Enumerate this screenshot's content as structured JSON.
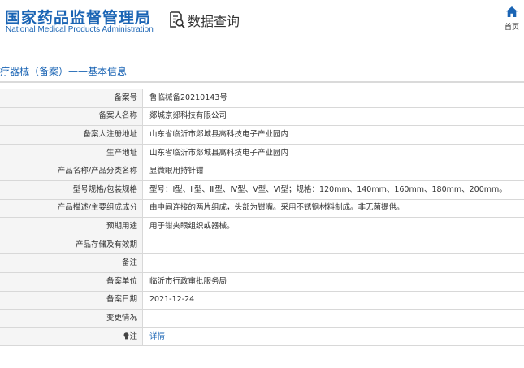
{
  "header": {
    "title_cn": "国家药品监督管理局",
    "title_en": "National Medical Products Administration",
    "query_title": "数据查询",
    "home_label": "首页"
  },
  "section": {
    "title": "医疗器械（备案）——基本信息"
  },
  "record": [
    {
      "label": "备案号",
      "value": "鲁临械备20210143号"
    },
    {
      "label": "备案人名称",
      "value": "郯城京郯科技有限公司"
    },
    {
      "label": "备案人注册地址",
      "value": "山东省临沂市郯城县高科技电子产业园内"
    },
    {
      "label": "生产地址",
      "value": "山东省临沂市郯城县高科技电子产业园内"
    },
    {
      "label": "产品名称/产品分类名称",
      "value": "显微眼用持针钳"
    },
    {
      "label": "型号规格/包装规格",
      "value": "型号：Ⅰ型、Ⅱ型、Ⅲ型、Ⅳ型、Ⅴ型、Ⅵ型；规格：120mm、140mm、160mm、180mm、200mm。"
    },
    {
      "label": "产品描述/主要组成成分",
      "value": "由中间连接的两片组成，头部为钳嘴。采用不锈钢材料制成。非无菌提供。"
    },
    {
      "label": "预期用途",
      "value": "用于钳夹眼组织或器械。"
    },
    {
      "label": "产品存储及有效期",
      "value": ""
    },
    {
      "label": "备注",
      "value": ""
    },
    {
      "label": "备案单位",
      "value": "临沂市行政审批服务局"
    },
    {
      "label": "备案日期",
      "value": "2021-12-24"
    },
    {
      "label": "变更情况",
      "value": ""
    },
    {
      "label": "注",
      "value": "详情"
    }
  ],
  "note_icon": "light-bulb-icon",
  "colors": {
    "brand": "#1a64b4",
    "label_bg": "#f5f5f5",
    "border": "#d8d8d8",
    "link": "#1a64b4"
  }
}
